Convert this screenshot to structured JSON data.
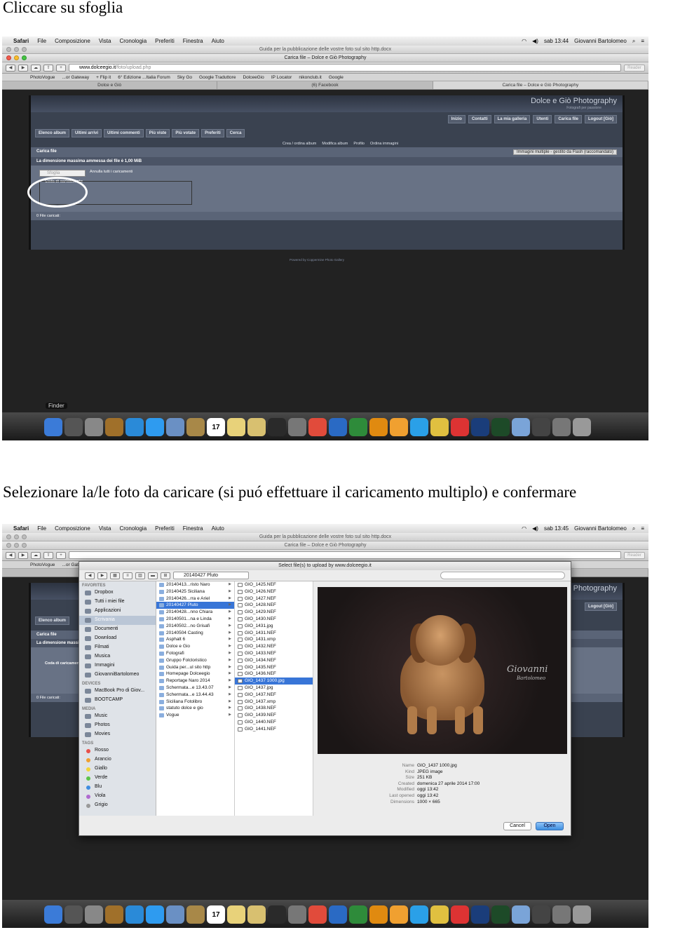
{
  "captions": {
    "step1": "Cliccare su sfoglia",
    "step2": "Selezionare la/le foto da caricare (si puó effettuare il caricamento multiplo) e confermare"
  },
  "menubar": {
    "app": "Safari",
    "items": [
      "File",
      "Composizione",
      "Vista",
      "Cronologia",
      "Preferiti",
      "Finestra",
      "Aiuto"
    ],
    "clock1": "sab 13:44",
    "clock2": "sab 13:45",
    "user": "Giovanni Bartolomeo"
  },
  "browser": {
    "doc_title": "Guida per la pubblicazione delle vostre foto sul sito http.docx",
    "window_title": "Carica file – Dolce e Giò Photography",
    "url_host": "www.dolceegio.it",
    "url_path": "/foto/upload.php",
    "reader": "Reader",
    "bookmarks": [
      "PhotoVogue",
      "...or Gateway",
      "+ Flip it",
      "6° Edizione ...Italia Forum",
      "Sky Go",
      "Google Traduttore",
      "DolceeGio",
      "IP Locator",
      "nikonclub.it",
      "Google"
    ],
    "tabs": [
      "Dolce e Giò",
      "(6) Facebook",
      "Carica file – Dolce e Giò Photography"
    ]
  },
  "site": {
    "title": "Dolce e Giò Photography",
    "subtitle": "Fotografi per passione",
    "nav_right": [
      "Inizio",
      "Contatti",
      "La mia galleria",
      "Utenti",
      "Carica file",
      "Logout [Giò]"
    ],
    "nav_left": [
      "Elenco album",
      "Ultimi arrivi",
      "Ultimi commenti",
      "Più viste",
      "Più votate",
      "Preferiti",
      "Cerca"
    ],
    "actions": [
      "Crea / ordina album",
      "Modifica album",
      "Profilo",
      "Ordina immagini"
    ],
    "upload_title": "Carica file",
    "mode": "Immagini multiple - gestito da Flash (raccomandato)",
    "max_size": "La dimensione massima ammessa dei file è 1,00 MiB",
    "browse": "Sfoglia",
    "cancel_all": "Annulla tutti i caricamenti",
    "queue": "Coda di caricamento",
    "files_loaded": "0 File caricati:",
    "powered": "Powered by Coppermine Photo Gallery"
  },
  "dock": {
    "finder_label": "Finder",
    "icons": [
      "finder-icon",
      "launchpad-icon",
      "rocket-icon",
      "fun-icon",
      "safari-icon",
      "appstore-icon",
      "mail-icon",
      "contacts-icon",
      "calendar-icon",
      "notes-icon",
      "preview-icon",
      "quicktime-icon",
      "utility-icon",
      "chrome-icon",
      "word-icon",
      "excel-icon",
      "office-icon",
      "picasa-icon",
      "skype-icon",
      "fireworks-icon",
      "pdf-icon",
      "photoshop-icon",
      "dreamweaver-icon",
      "folder-icon",
      "photobooth-icon",
      "camera-icon",
      "trash-icon"
    ],
    "calendar_day": "17"
  },
  "dialog": {
    "title": "Select file(s) to upload by www.dolceegio.it",
    "folder": "20140427 Pluto",
    "sidebar": {
      "favorites_h": "FAVORITES",
      "favorites": [
        "Dropbox",
        "Tutti i miei file",
        "Applicazioni",
        "Scrivania",
        "Documenti",
        "Download",
        "Filmati",
        "Musica",
        "Immagini",
        "GiovanniBartolomeo"
      ],
      "devices_h": "DEVICES",
      "devices": [
        "MacBook Pro di Giov...",
        "BOOTCAMP"
      ],
      "media_h": "MEDIA",
      "media": [
        "Music",
        "Photos",
        "Movies"
      ],
      "tags_h": "TAGS",
      "tags": [
        {
          "name": "Rosso",
          "color": "#e8504a"
        },
        {
          "name": "Arancio",
          "color": "#f0a030"
        },
        {
          "name": "Giallo",
          "color": "#f1d43a"
        },
        {
          "name": "Verde",
          "color": "#5cc448"
        },
        {
          "name": "Blu",
          "color": "#3f8de0"
        },
        {
          "name": "Viola",
          "color": "#b06ad0"
        },
        {
          "name": "Grigio",
          "color": "#999999"
        }
      ]
    },
    "folders": [
      "20140413...risto Naro",
      "20140425 Siciliana",
      "20140426...rra e Ariel",
      "20140427 Pluto",
      "20140428...nno Chiara",
      "20140501...na e Linda",
      "20140502...no Grisafi",
      "20140504 Casting",
      "Asphalt 6",
      "Dolce e Gio",
      "Fotografi",
      "Gruppo Folcloristico",
      "Guida per...ul sito http",
      "Homepage Dolceegio",
      "Reportage Naro 2014",
      "Schermata...e 13.43.07",
      "Schermata...e 13.44.43",
      "Siciliana Fotolibro",
      "statuto dolce e gio",
      "Vogue"
    ],
    "files": [
      "GIO_1425.NEF",
      "GIO_1426.NEF",
      "GIO_1427.NEF",
      "GIO_1428.NEF",
      "GIO_1429.NEF",
      "GIO_1430.NEF",
      "GIO_1431.jpg",
      "GIO_1431.NEF",
      "GIO_1431.xmp",
      "GIO_1432.NEF",
      "GIO_1433.NEF",
      "GIO_1434.NEF",
      "GIO_1435.NEF",
      "GIO_1436.NEF",
      "GIO_1437 1000.jpg",
      "GIO_1437.jpg",
      "GIO_1437.NEF",
      "GIO_1437.xmp",
      "GIO_1438.NEF",
      "GIO_1439.NEF",
      "GIO_1440.NEF",
      "GIO_1441.NEF"
    ],
    "selected_file_index": 14,
    "selected_folder_index": 3,
    "signature_top": "Giovanni",
    "signature_bottom": "Bartolomeo",
    "info": [
      {
        "k": "Name",
        "v": "GIO_1437 1000.jpg"
      },
      {
        "k": "Kind",
        "v": "JPEG image"
      },
      {
        "k": "Size",
        "v": "251 KB"
      },
      {
        "k": "Created",
        "v": "domenica 27 aprile 2014 17:00"
      },
      {
        "k": "Modified",
        "v": "oggi 13:42"
      },
      {
        "k": "Last opened",
        "v": "oggi 13:42"
      },
      {
        "k": "Dimensions",
        "v": "1000 × 665"
      }
    ],
    "cancel": "Cancel",
    "open": "Open"
  }
}
